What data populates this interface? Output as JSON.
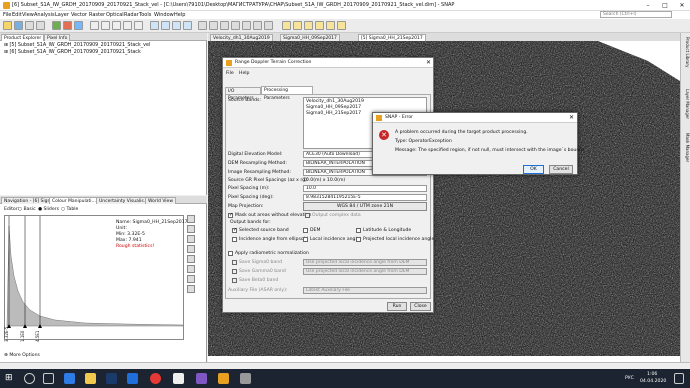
{
  "window": {
    "title": "[6] Subset_S1A_IW_GRDH_20170909_20170921_Stack_vel - [C:\\Users\\79101\\Desktop\\MAГИСТРАТУРА\\СНАР\\Subset_S1A_IW_GRDH_20170909_20170921_Stack_vel.dim] - SNAP"
  },
  "menu": [
    "File",
    "Edit",
    "View",
    "Analysis",
    "Layer",
    "Vector",
    "Raster",
    "Optical",
    "Radar",
    "Tools",
    "Window",
    "Help"
  ],
  "search": {
    "placeholder": "Search (Ctrl+I)"
  },
  "left_tabs": [
    "Product Explorer",
    "Pixel Info"
  ],
  "products": [
    "[5] Subset_S1A_IW_GRDH_20170909_20170921_Stack_vel",
    "[6] Subset_S1A_IW_GRDH_20170909_20170921_Stack"
  ],
  "nav_tabs": [
    "Navigation - [6] Sign...",
    "Colour Manipulati...",
    "Uncertainty Visualis...",
    "World View"
  ],
  "editor": {
    "label": "Editor:",
    "options": [
      "Basic",
      "Sliders",
      "Table"
    ],
    "selected": "Sliders"
  },
  "band_info": {
    "name": "Name: Sigma0_HH_21Sep2017",
    "unit": "Unit:",
    "min": "Min: 3.32E-5",
    "max": "Max: 7.941",
    "note": "Rough statistics!"
  },
  "axis": {
    "ticks": [
      "3.32E-5",
      "1.1E0",
      "4.5E1"
    ]
  },
  "more_options": "More Options",
  "view_tabs": [
    "Velocity_dh1_30Aug2019",
    "Sigma0_HH_09Sep2017",
    "[5] Sigma0_HH_21Sep2017"
  ],
  "right_tabs": [
    "Product Library",
    "Layer Manager",
    "Mask Manager"
  ],
  "dialog": {
    "title": "Range Doppler Terrain Correction",
    "menu": [
      "File",
      "Help"
    ],
    "tabs": [
      "I/O Parameters",
      "Processing Parameters"
    ],
    "source_bands_label": "Source Bands:",
    "source_bands": [
      "Velocity_dh1_30Aug2019",
      "Sigma0_HH_09Sep2017",
      "Sigma0_HH_21Sep2017"
    ],
    "dem_label": "Digital Elevation Model:",
    "dem": "ACE30 (Auto Download)",
    "dem_resamp_label": "DEM Resampling Method:",
    "dem_resamp": "BILINEAR_INTERPOLATION",
    "img_resamp_label": "Image Resampling Method:",
    "img_resamp": "BILINEAR_INTERPOLATION",
    "src_px_label": "Source GR Pixel Spacings (az x rg):",
    "src_px": "10.0(m) x 10.0(m)",
    "px_m_label": "Pixel Spacing (m):",
    "px_m": "10.0",
    "px_deg_label": "Pixel Spacing (deg):",
    "px_deg": "8.983152841195215E-5",
    "proj_label": "Map Projection:",
    "proj": "WGS 84 / UTM zone 21N",
    "mask_label": "Mask out areas without elevation",
    "complex_label": "Output complex data",
    "output_label": "Output bands for:",
    "cb": [
      "Selected source band",
      "DEM",
      "Latitude & Longitude",
      "Incidence angle from ellipsoid",
      "Local incidence angle",
      "Projected local incidence angle"
    ],
    "radiometric": "Apply radiometric normalization",
    "save_sigma": "Save Sigma0 band",
    "save_gamma": "Save Gamma0 band",
    "save_beta": "Save Beta0 band",
    "use_proj": "Use projected local incidence angle from DEM",
    "aux_label": "Auxiliary File (ASAR only):",
    "aux": "Latest Auxiliary File",
    "run": "Run",
    "close": "Close"
  },
  "error": {
    "title": "SNAP - Error",
    "line1": "A problem occurred during the target product processing.",
    "line2": "Type: OperatorException",
    "line3": "Message: The specified region, if not null, must intersect with the image`s bounds.",
    "ok": "OK",
    "cancel": "Cancel"
  },
  "taskbar": {
    "lang": "РУС",
    "time": "1:06",
    "date": "04.04.2020"
  },
  "colors": {
    "error_icon": "#c62828",
    "accent": "#1e6fd9",
    "brand": "#e8a020"
  }
}
